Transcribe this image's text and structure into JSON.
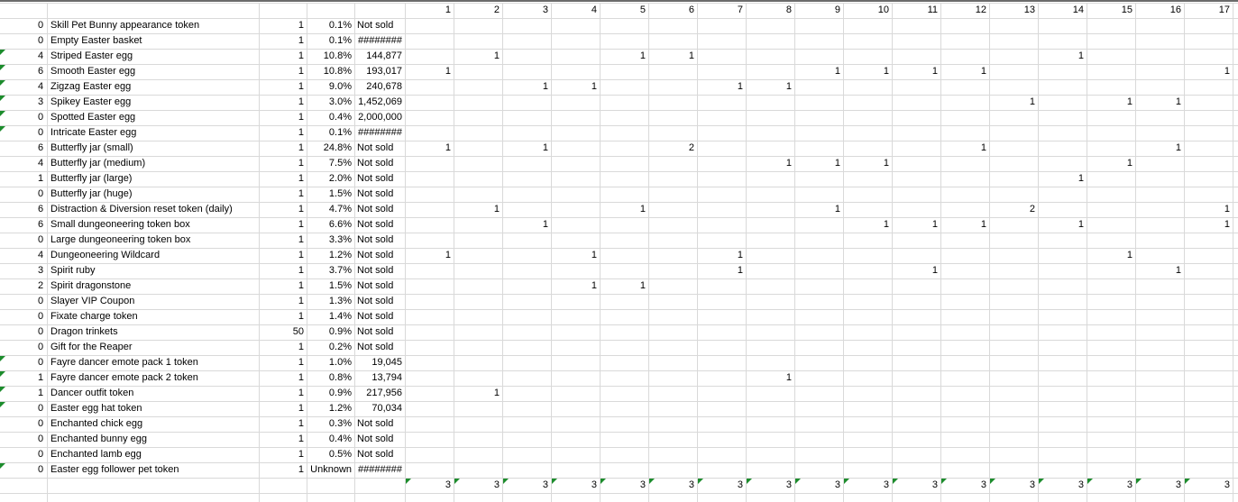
{
  "header": {
    "columns": [
      "1",
      "2",
      "3",
      "4",
      "5",
      "6",
      "7",
      "8",
      "9",
      "10",
      "11",
      "12",
      "13",
      "14",
      "15",
      "16",
      "17"
    ]
  },
  "rows": [
    {
      "count": "0",
      "name": "Skill Pet Bunny appearance token",
      "qty": "1",
      "pct": "0.1%",
      "price": "Not sold",
      "cells": {}
    },
    {
      "count": "0",
      "name": "Empty Easter basket",
      "qty": "1",
      "pct": "0.1%",
      "price": "########",
      "cells": {}
    },
    {
      "count": "4",
      "name": "Striped Easter egg",
      "qty": "1",
      "pct": "10.8%",
      "price": "144,877",
      "cells": {
        "2": "1",
        "5": "1",
        "6": "1",
        "14": "1"
      }
    },
    {
      "count": "6",
      "name": "Smooth Easter egg",
      "qty": "1",
      "pct": "10.8%",
      "price": "193,017",
      "cells": {
        "1": "1",
        "9": "1",
        "10": "1",
        "11": "1",
        "12": "1",
        "17": "1"
      }
    },
    {
      "count": "4",
      "name": "Zigzag Easter egg",
      "qty": "1",
      "pct": "9.0%",
      "price": "240,678",
      "cells": {
        "3": "1",
        "4": "1",
        "7": "1",
        "8": "1"
      }
    },
    {
      "count": "3",
      "name": "Spikey Easter egg",
      "qty": "1",
      "pct": "3.0%",
      "price": "1,452,069",
      "cells": {
        "13": "1",
        "15": "1",
        "16": "1"
      }
    },
    {
      "count": "0",
      "name": "Spotted Easter egg",
      "qty": "1",
      "pct": "0.4%",
      "price": "2,000,000",
      "cells": {}
    },
    {
      "count": "0",
      "name": "Intricate Easter egg",
      "qty": "1",
      "pct": "0.1%",
      "price": "########",
      "cells": {}
    },
    {
      "count": "6",
      "name": "Butterfly jar (small)",
      "qty": "1",
      "pct": "24.8%",
      "price": "Not sold",
      "cells": {
        "1": "1",
        "3": "1",
        "6": "2",
        "12": "1",
        "16": "1"
      }
    },
    {
      "count": "4",
      "name": "Butterfly jar (medium)",
      "qty": "1",
      "pct": "7.5%",
      "price": "Not sold",
      "cells": {
        "8": "1",
        "9": "1",
        "10": "1",
        "15": "1"
      }
    },
    {
      "count": "1",
      "name": "Butterfly jar (large)",
      "qty": "1",
      "pct": "2.0%",
      "price": "Not sold",
      "cells": {
        "14": "1"
      }
    },
    {
      "count": "0",
      "name": "Butterfly jar (huge)",
      "qty": "1",
      "pct": "1.5%",
      "price": "Not sold",
      "cells": {}
    },
    {
      "count": "6",
      "name": "Distraction & Diversion reset token (daily)",
      "qty": "1",
      "pct": "4.7%",
      "price": "Not sold",
      "cells": {
        "2": "1",
        "5": "1",
        "9": "1",
        "13": "2",
        "17": "1"
      }
    },
    {
      "count": "6",
      "name": "Small dungeoneering token box",
      "qty": "1",
      "pct": "6.6%",
      "price": "Not sold",
      "cells": {
        "3": "1",
        "10": "1",
        "11": "1",
        "12": "1",
        "14": "1",
        "17": "1"
      }
    },
    {
      "count": "0",
      "name": "Large dungeoneering token box",
      "qty": "1",
      "pct": "3.3%",
      "price": "Not sold",
      "cells": {}
    },
    {
      "count": "4",
      "name": "Dungeoneering Wildcard",
      "qty": "1",
      "pct": "1.2%",
      "price": "Not sold",
      "cells": {
        "1": "1",
        "4": "1",
        "7": "1",
        "15": "1"
      }
    },
    {
      "count": "3",
      "name": "Spirit ruby",
      "qty": "1",
      "pct": "3.7%",
      "price": "Not sold",
      "cells": {
        "7": "1",
        "11": "1",
        "16": "1"
      }
    },
    {
      "count": "2",
      "name": "Spirit dragonstone",
      "qty": "1",
      "pct": "1.5%",
      "price": "Not sold",
      "cells": {
        "4": "1",
        "5": "1"
      }
    },
    {
      "count": "0",
      "name": "Slayer VIP Coupon",
      "qty": "1",
      "pct": "1.3%",
      "price": "Not sold",
      "cells": {}
    },
    {
      "count": "0",
      "name": "Fixate charge token",
      "qty": "1",
      "pct": "1.4%",
      "price": "Not sold",
      "cells": {}
    },
    {
      "count": "0",
      "name": "Dragon trinkets",
      "qty": "50",
      "pct": "0.9%",
      "price": "Not sold",
      "cells": {}
    },
    {
      "count": "0",
      "name": "Gift for the Reaper",
      "qty": "1",
      "pct": "0.2%",
      "price": "Not sold",
      "cells": {}
    },
    {
      "count": "0",
      "name": "Fayre dancer emote pack 1 token",
      "qty": "1",
      "pct": "1.0%",
      "price": "19,045",
      "cells": {}
    },
    {
      "count": "1",
      "name": "Fayre dancer emote pack 2 token",
      "qty": "1",
      "pct": "0.8%",
      "price": "13,794",
      "cells": {
        "8": "1"
      }
    },
    {
      "count": "1",
      "name": "Dancer outfit token",
      "qty": "1",
      "pct": "0.9%",
      "price": "217,956",
      "cells": {
        "2": "1"
      }
    },
    {
      "count": "0",
      "name": "Easter egg hat token",
      "qty": "1",
      "pct": "1.2%",
      "price": "70,034",
      "cells": {}
    },
    {
      "count": "0",
      "name": "Enchanted chick egg",
      "qty": "1",
      "pct": "0.3%",
      "price": "Not sold",
      "cells": {}
    },
    {
      "count": "0",
      "name": "Enchanted bunny egg",
      "qty": "1",
      "pct": "0.4%",
      "price": "Not sold",
      "cells": {}
    },
    {
      "count": "0",
      "name": "Enchanted lamb egg",
      "qty": "1",
      "pct": "0.5%",
      "price": "Not sold",
      "cells": {}
    },
    {
      "count": "0",
      "name": "Easter egg follower pet token",
      "qty": "1",
      "pct": "Unknown",
      "price": "########",
      "cells": {}
    }
  ],
  "totals": [
    "3",
    "3",
    "3",
    "3",
    "3",
    "3",
    "3",
    "3",
    "3",
    "3",
    "3",
    "3",
    "3",
    "3",
    "3",
    "3",
    "3"
  ],
  "colors": {
    "gridline": "#d9d9d9",
    "top_border": "#6b6b6b",
    "error_marker": "#1c8c2c"
  },
  "icons": [
    "formula-warning-triangle-icon"
  ]
}
